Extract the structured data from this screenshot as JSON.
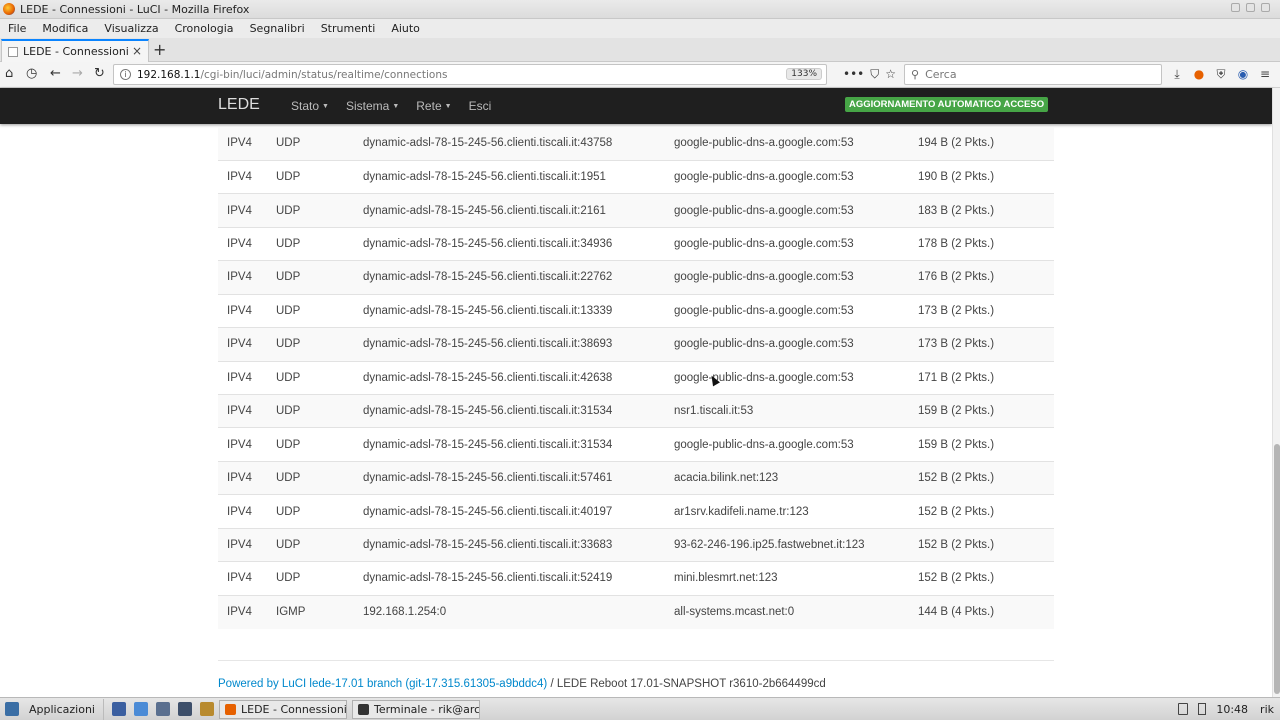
{
  "window": {
    "title": "LEDE - Connessioni - LuCI - Mozilla Firefox"
  },
  "menubar": {
    "items": [
      "File",
      "Modifica",
      "Visualizza",
      "Cronologia",
      "Segnalibri",
      "Strumenti",
      "Aiuto"
    ]
  },
  "tab": {
    "title": "LEDE - Connessioni - L",
    "close": "×"
  },
  "newtab": "+",
  "url": {
    "host": "192.168.1.1",
    "path": "/cgi-bin/luci/admin/status/realtime/connections",
    "zoom": "133%"
  },
  "search": {
    "placeholder": "Cerca"
  },
  "luci": {
    "brand": "LEDE",
    "nav": [
      "Stato",
      "Sistema",
      "Rete",
      "Esci"
    ],
    "auto_refresh": "AGGIORNAMENTO AUTOMATICO ACCESO"
  },
  "connections": [
    {
      "family": "IPV4",
      "proto": "UDP",
      "src": "dynamic-adsl-78-15-245-56.clienti.tiscali.it:43758",
      "dst": "google-public-dns-a.google.com:53",
      "transfer": "194 B (2 Pkts.)"
    },
    {
      "family": "IPV4",
      "proto": "UDP",
      "src": "dynamic-adsl-78-15-245-56.clienti.tiscali.it:1951",
      "dst": "google-public-dns-a.google.com:53",
      "transfer": "190 B (2 Pkts.)"
    },
    {
      "family": "IPV4",
      "proto": "UDP",
      "src": "dynamic-adsl-78-15-245-56.clienti.tiscali.it:2161",
      "dst": "google-public-dns-a.google.com:53",
      "transfer": "183 B (2 Pkts.)"
    },
    {
      "family": "IPV4",
      "proto": "UDP",
      "src": "dynamic-adsl-78-15-245-56.clienti.tiscali.it:34936",
      "dst": "google-public-dns-a.google.com:53",
      "transfer": "178 B (2 Pkts.)"
    },
    {
      "family": "IPV4",
      "proto": "UDP",
      "src": "dynamic-adsl-78-15-245-56.clienti.tiscali.it:22762",
      "dst": "google-public-dns-a.google.com:53",
      "transfer": "176 B (2 Pkts.)"
    },
    {
      "family": "IPV4",
      "proto": "UDP",
      "src": "dynamic-adsl-78-15-245-56.clienti.tiscali.it:13339",
      "dst": "google-public-dns-a.google.com:53",
      "transfer": "173 B (2 Pkts.)"
    },
    {
      "family": "IPV4",
      "proto": "UDP",
      "src": "dynamic-adsl-78-15-245-56.clienti.tiscali.it:38693",
      "dst": "google-public-dns-a.google.com:53",
      "transfer": "173 B (2 Pkts.)"
    },
    {
      "family": "IPV4",
      "proto": "UDP",
      "src": "dynamic-adsl-78-15-245-56.clienti.tiscali.it:42638",
      "dst": "google-public-dns-a.google.com:53",
      "transfer": "171 B (2 Pkts.)"
    },
    {
      "family": "IPV4",
      "proto": "UDP",
      "src": "dynamic-adsl-78-15-245-56.clienti.tiscali.it:31534",
      "dst": "nsr1.tiscali.it:53",
      "transfer": "159 B (2 Pkts.)"
    },
    {
      "family": "IPV4",
      "proto": "UDP",
      "src": "dynamic-adsl-78-15-245-56.clienti.tiscali.it:31534",
      "dst": "google-public-dns-a.google.com:53",
      "transfer": "159 B (2 Pkts.)"
    },
    {
      "family": "IPV4",
      "proto": "UDP",
      "src": "dynamic-adsl-78-15-245-56.clienti.tiscali.it:57461",
      "dst": "acacia.bilink.net:123",
      "transfer": "152 B (2 Pkts.)"
    },
    {
      "family": "IPV4",
      "proto": "UDP",
      "src": "dynamic-adsl-78-15-245-56.clienti.tiscali.it:40197",
      "dst": "ar1srv.kadifeli.name.tr:123",
      "transfer": "152 B (2 Pkts.)"
    },
    {
      "family": "IPV4",
      "proto": "UDP",
      "src": "dynamic-adsl-78-15-245-56.clienti.tiscali.it:33683",
      "dst": "93-62-246-196.ip25.fastwebnet.it:123",
      "transfer": "152 B (2 Pkts.)"
    },
    {
      "family": "IPV4",
      "proto": "UDP",
      "src": "dynamic-adsl-78-15-245-56.clienti.tiscali.it:52419",
      "dst": "mini.blesmrt.net:123",
      "transfer": "152 B (2 Pkts.)"
    },
    {
      "family": "IPV4",
      "proto": "IGMP",
      "src": "192.168.1.254:0",
      "dst": "all-systems.mcast.net:0",
      "transfer": "144 B (4 Pkts.)"
    }
  ],
  "footer": {
    "powered": "Powered by LuCI lede-17.01 branch (git-17.315.61305-a9bddc4)",
    "version": " / LEDE Reboot 17.01-SNAPSHOT r3610-2b664499cd"
  },
  "taskbar": {
    "start_label": "Applicazioni",
    "tasks": [
      "LEDE - Connessioni -...",
      "Terminale - rik@arch..."
    ],
    "clock": "10:48",
    "user": "rik"
  },
  "colors": {
    "header_bg": "#1f1f1f",
    "badge_green": "#46a546",
    "link_blue": "#0088cc",
    "tab_accent": "#0a84ff"
  },
  "icons": [
    "home-icon",
    "history-icon",
    "back-icon",
    "forward-icon",
    "reload-icon",
    "info-icon",
    "more-icon",
    "pocket-icon",
    "star-icon",
    "search-icon",
    "download-icon",
    "extension-icon",
    "menu-icon"
  ]
}
